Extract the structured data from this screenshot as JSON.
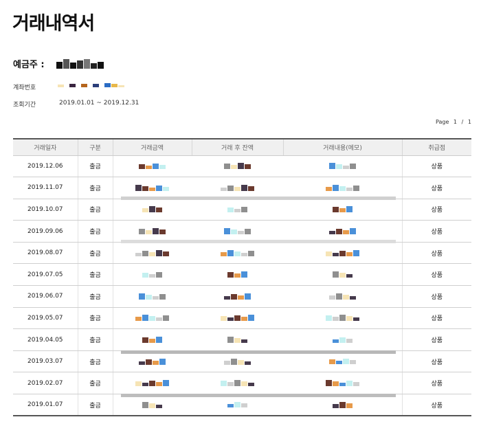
{
  "document": {
    "title": "거래내역서",
    "owner_label": "예금주 :",
    "account_label": "계좌번호",
    "period_label": "조회기간",
    "period_value": "2019.01.01 ~ 2019.12.31",
    "page": {
      "label": "Page",
      "current": "1",
      "separator": "/",
      "total": "1"
    }
  },
  "table": {
    "headers": [
      "거래일자",
      "구분",
      "거래금액",
      "거래 후 잔액",
      "거래내용(메모)",
      "취급점"
    ],
    "rows": [
      {
        "date": "2019.12.06",
        "type": "출금",
        "branch": "상품"
      },
      {
        "date": "2019.11.07",
        "type": "출금",
        "branch": "상품"
      },
      {
        "date": "2019.10.07",
        "type": "출금",
        "branch": "상품"
      },
      {
        "date": "2019.09.06",
        "type": "출금",
        "branch": "상품"
      },
      {
        "date": "2019.08.07",
        "type": "출금",
        "branch": "상품"
      },
      {
        "date": "2019.07.05",
        "type": "출금",
        "branch": "상품"
      },
      {
        "date": "2019.06.07",
        "type": "출금",
        "branch": "상품"
      },
      {
        "date": "2019.05.07",
        "type": "출금",
        "branch": "상품"
      },
      {
        "date": "2019.04.05",
        "type": "출금",
        "branch": "상품"
      },
      {
        "date": "2019.03.07",
        "type": "출금",
        "branch": "상품"
      },
      {
        "date": "2019.02.07",
        "type": "출금",
        "branch": "상품"
      },
      {
        "date": "2019.01.07",
        "type": "출금",
        "branch": "상품"
      }
    ]
  },
  "redaction_colors": [
    "#e79a4a",
    "#f6e4b5",
    "#c3f0f0",
    "#6b3a2e",
    "#8f8f8f",
    "#4a90d9",
    "#463a4c",
    "#cfcfcf"
  ]
}
